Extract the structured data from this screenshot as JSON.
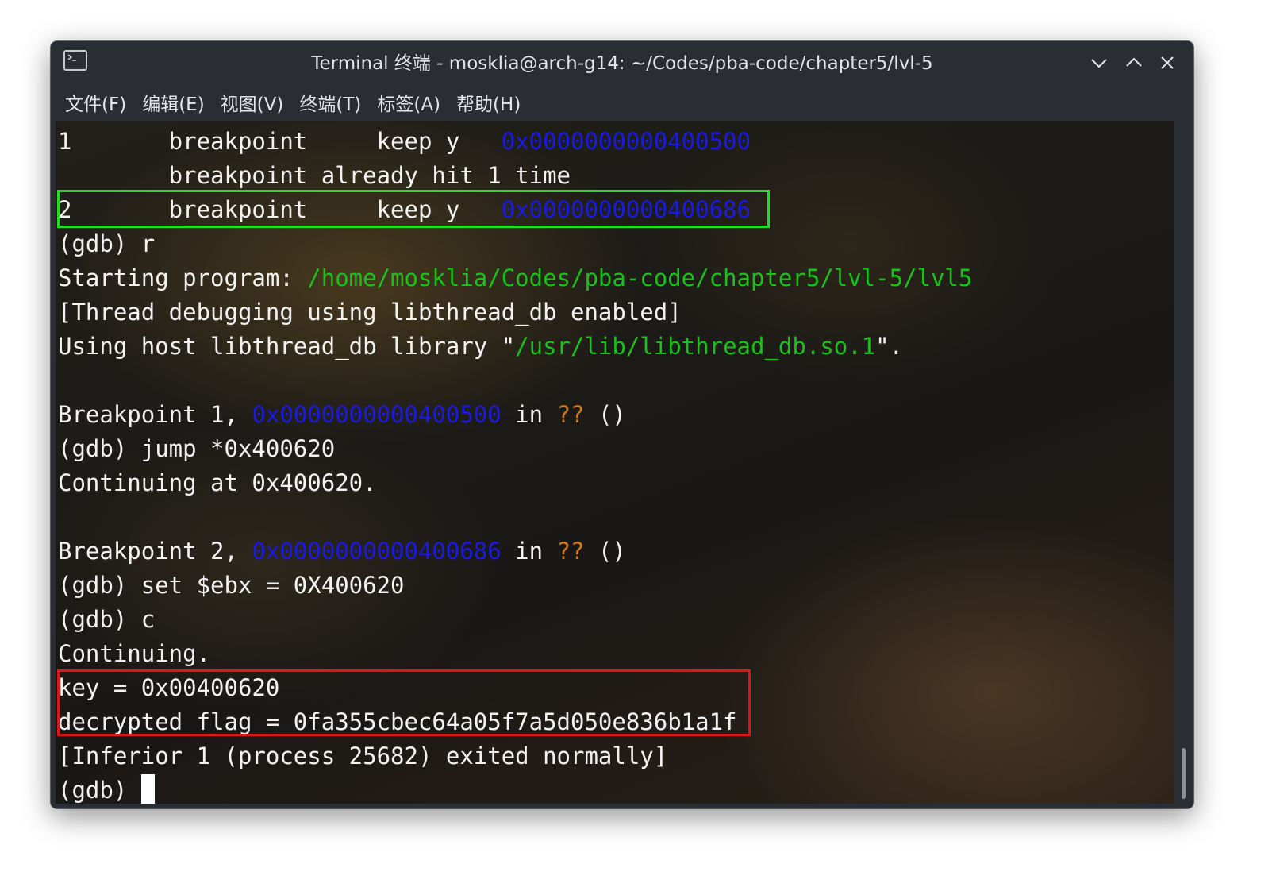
{
  "window": {
    "title": "Terminal 终端 - mosklia@arch-g14: ~/Codes/pba-code/chapter5/lvl-5",
    "app_icon": "terminal-icon",
    "controls": [
      {
        "name": "minimize",
        "icon": "chevron-down-icon"
      },
      {
        "name": "maximize",
        "icon": "chevron-up-icon"
      },
      {
        "name": "close",
        "icon": "close-icon"
      }
    ]
  },
  "menu": {
    "items": [
      "文件(F)",
      "编辑(E)",
      "视图(V)",
      "终端(T)",
      "标签(A)",
      "帮助(H)"
    ]
  },
  "colors": {
    "text": "#f2f2f2",
    "green": "#19c219",
    "blue": "#1a1ae0",
    "orange": "#d17a14",
    "highlight_green": "#1fe01f",
    "highlight_red": "#e01616"
  },
  "terminal": {
    "lines": [
      [
        {
          "t": "1       breakpoint     keep y   "
        },
        {
          "t": "0x0000000000400500",
          "c": "blue"
        }
      ],
      [
        {
          "t": "        breakpoint already hit 1 time"
        }
      ],
      [
        {
          "t": "2       breakpoint     keep y   "
        },
        {
          "t": "0x0000000000400686",
          "c": "blue"
        }
      ],
      [
        {
          "t": "(gdb) r"
        }
      ],
      [
        {
          "t": "Starting program: "
        },
        {
          "t": "/home/mosklia/Codes/pba-code/chapter5/lvl-5/lvl5",
          "c": "green"
        }
      ],
      [
        {
          "t": "[Thread debugging using libthread_db enabled]"
        }
      ],
      [
        {
          "t": "Using host libthread_db library \""
        },
        {
          "t": "/usr/lib/libthread_db.so.1",
          "c": "green"
        },
        {
          "t": "\"."
        }
      ],
      [],
      [
        {
          "t": "Breakpoint 1, "
        },
        {
          "t": "0x0000000000400500",
          "c": "blue"
        },
        {
          "t": " in "
        },
        {
          "t": "??",
          "c": "orange"
        },
        {
          "t": " ()"
        }
      ],
      [
        {
          "t": "(gdb) jump *0x400620"
        }
      ],
      [
        {
          "t": "Continuing at 0x400620."
        }
      ],
      [],
      [
        {
          "t": "Breakpoint 2, "
        },
        {
          "t": "0x0000000000400686",
          "c": "blue"
        },
        {
          "t": " in "
        },
        {
          "t": "??",
          "c": "orange"
        },
        {
          "t": " ()"
        }
      ],
      [
        {
          "t": "(gdb) set $ebx = 0X400620"
        }
      ],
      [
        {
          "t": "(gdb) c"
        }
      ],
      [
        {
          "t": "Continuing."
        }
      ],
      [
        {
          "t": "key = 0x00400620"
        }
      ],
      [
        {
          "t": "decrypted flag = 0fa355cbec64a05f7a5d050e836b1a1f"
        }
      ],
      [
        {
          "t": "[Inferior 1 (process 25682) exited normally]"
        }
      ],
      [
        {
          "t": "(gdb) "
        }
      ]
    ],
    "prompt_has_cursor": true
  }
}
